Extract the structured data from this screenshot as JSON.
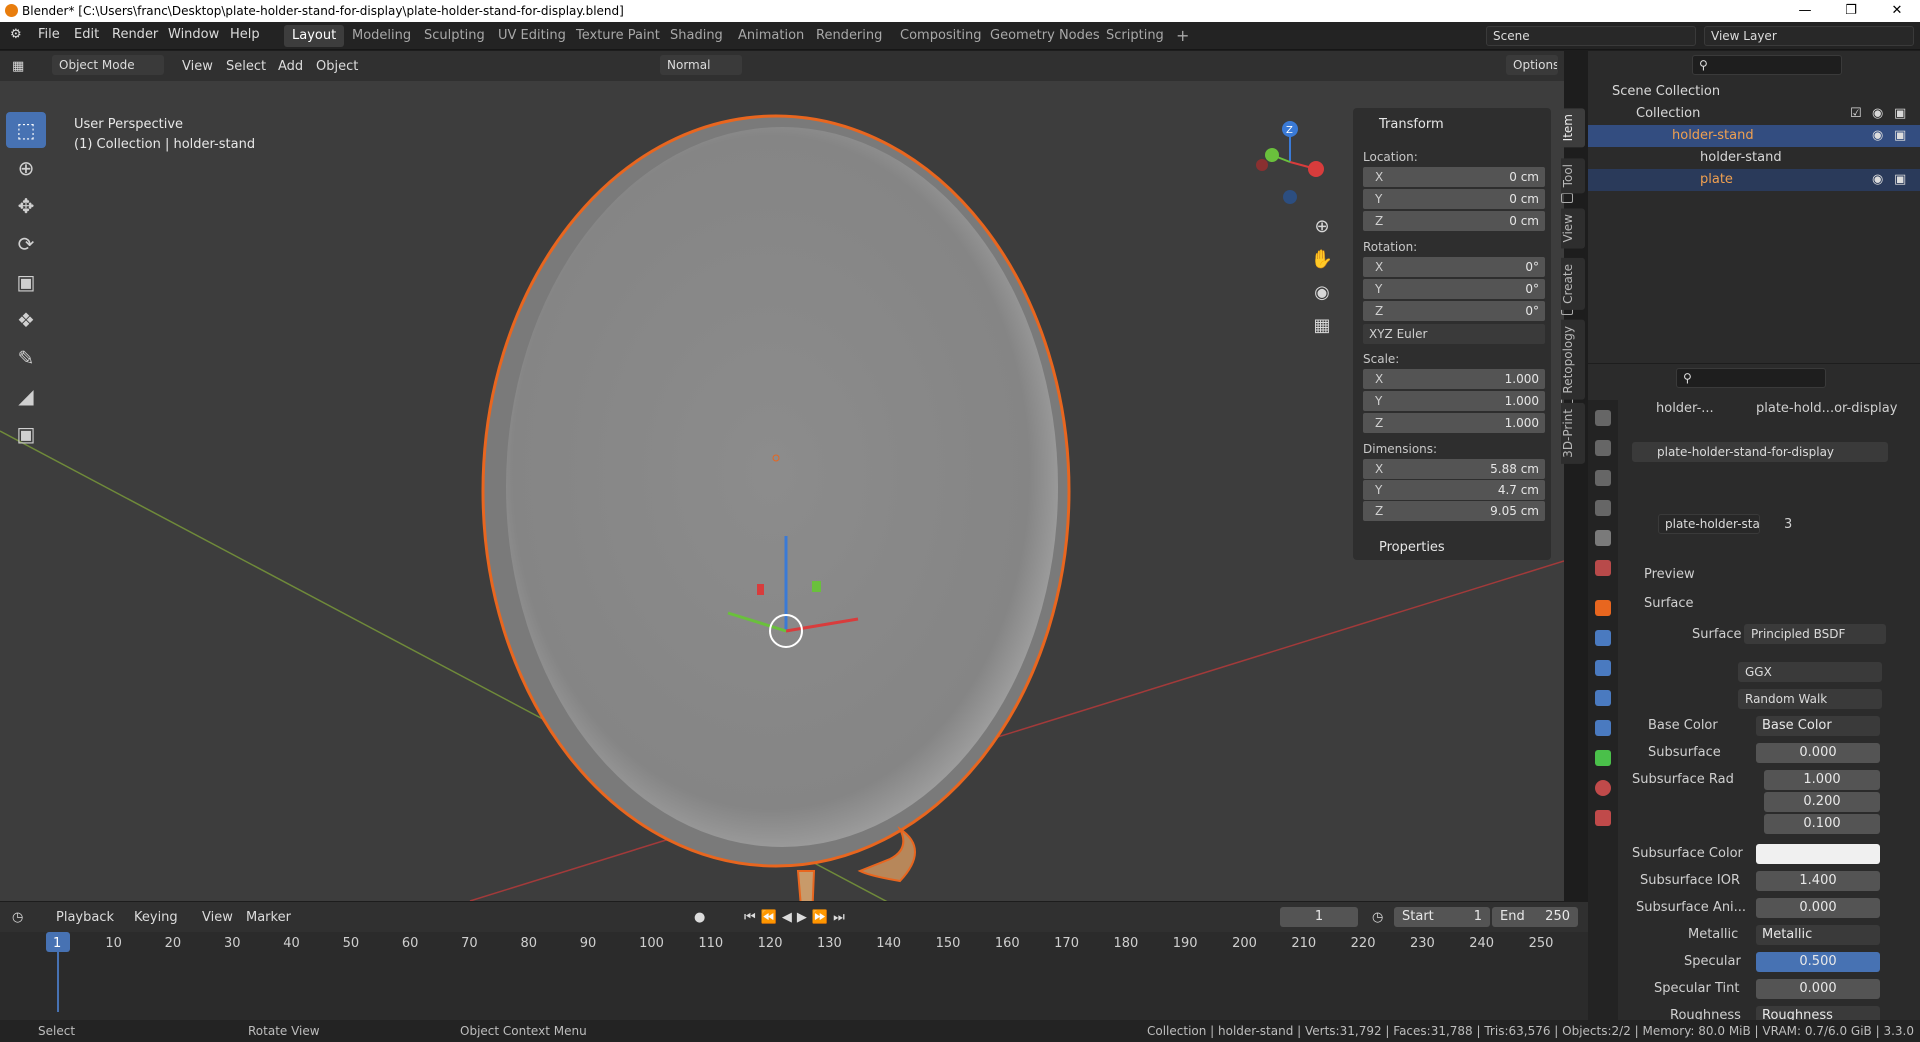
{
  "window": {
    "title": "Blender* [C:\\Users\\franc\\Desktop\\plate-holder-stand-for-display\\plate-holder-stand-for-display.blend]"
  },
  "menu": [
    "File",
    "Edit",
    "Render",
    "Window",
    "Help"
  ],
  "workspaces": [
    "Layout",
    "Modeling",
    "Sculpting",
    "UV Editing",
    "Texture Paint",
    "Shading",
    "Animation",
    "Rendering",
    "Compositing",
    "Geometry Nodes",
    "Scripting"
  ],
  "scene": {
    "label": "Scene",
    "view_layer": "View Layer"
  },
  "viewport": {
    "mode": "Object Mode",
    "menu": [
      "View",
      "Select",
      "Add",
      "Object"
    ],
    "orientation": "Normal",
    "options": "Options",
    "perspective": "User Perspective",
    "collection_info": "(1) Collection | holder-stand"
  },
  "npanel": {
    "title": "Transform",
    "location_label": "Location:",
    "location": [
      {
        "axis": "X",
        "value": "0 cm"
      },
      {
        "axis": "Y",
        "value": "0 cm"
      },
      {
        "axis": "Z",
        "value": "0 cm"
      }
    ],
    "rotation_label": "Rotation:",
    "rotation": [
      {
        "axis": "X",
        "value": "0°"
      },
      {
        "axis": "Y",
        "value": "0°"
      },
      {
        "axis": "Z",
        "value": "0°"
      }
    ],
    "rotation_mode": "XYZ Euler",
    "scale_label": "Scale:",
    "scale": [
      {
        "axis": "X",
        "value": "1.000"
      },
      {
        "axis": "Y",
        "value": "1.000"
      },
      {
        "axis": "Z",
        "value": "1.000"
      }
    ],
    "dimensions_label": "Dimensions:",
    "dimensions": [
      {
        "axis": "X",
        "value": "5.88 cm"
      },
      {
        "axis": "Y",
        "value": "4.7 cm"
      },
      {
        "axis": "Z",
        "value": "9.05 cm"
      }
    ],
    "properties": "Properties",
    "tabs": [
      "Item",
      "Tool",
      "View",
      "Create",
      "Retopology",
      "3D-Print"
    ]
  },
  "outliner": {
    "rows": [
      {
        "label": "Scene Collection"
      },
      {
        "label": "Collection"
      },
      {
        "label": "holder-stand"
      },
      {
        "label": "holder-stand"
      },
      {
        "label": "plate"
      }
    ]
  },
  "properties": {
    "breadcrumb_object": "holder-...",
    "breadcrumb_material": "plate-hold...or-display",
    "material_slot": "plate-holder-stand-for-display",
    "material_name": "plate-holder-stan...",
    "user_count": "3",
    "preview": "Preview",
    "surface_section": "Surface",
    "surface_label": "Surface",
    "surface_shader": "Principled BSDF",
    "distribution": "GGX",
    "subsurface_method": "Random Walk",
    "fields": [
      {
        "label": "Base Color",
        "value": "Base Color"
      },
      {
        "label": "Subsurface",
        "value": "0.000"
      },
      {
        "label": "Subsurface Rad",
        "value": "1.000"
      },
      {
        "label": "",
        "value": "0.200"
      },
      {
        "label": "",
        "value": "0.100"
      },
      {
        "label": "Subsurface Color",
        "value": ""
      },
      {
        "label": "Subsurface IOR",
        "value": "1.400"
      },
      {
        "label": "Subsurface Ani...",
        "value": "0.000"
      },
      {
        "label": "Metallic",
        "value": "Metallic"
      },
      {
        "label": "Specular",
        "value": "0.500"
      },
      {
        "label": "Specular Tint",
        "value": "0.000"
      },
      {
        "label": "Roughness",
        "value": "Roughness"
      }
    ]
  },
  "timeline": {
    "menu": [
      "Playback",
      "Keying",
      "View",
      "Marker"
    ],
    "current_frame": "1",
    "start_label": "Start",
    "start": "1",
    "end_label": "End",
    "end": "250",
    "frames": [
      "1",
      "10",
      "20",
      "30",
      "40",
      "50",
      "60",
      "70",
      "80",
      "90",
      "100",
      "110",
      "120",
      "130",
      "140",
      "150",
      "160",
      "170",
      "180",
      "190",
      "200",
      "210",
      "220",
      "230",
      "240",
      "250"
    ]
  },
  "status": {
    "select": "Select",
    "rotate": "Rotate View",
    "context": "Object Context Menu",
    "stats": "Collection | holder-stand | Verts:31,792 | Faces:31,788 | Tris:63,576 | Objects:2/2 | Memory: 80.0 MiB | VRAM: 0.7/6.0 GiB | 3.3.0"
  },
  "colors": {
    "accent": "#4772b3",
    "selection": "#e8661f",
    "active_row": "#334d80"
  }
}
